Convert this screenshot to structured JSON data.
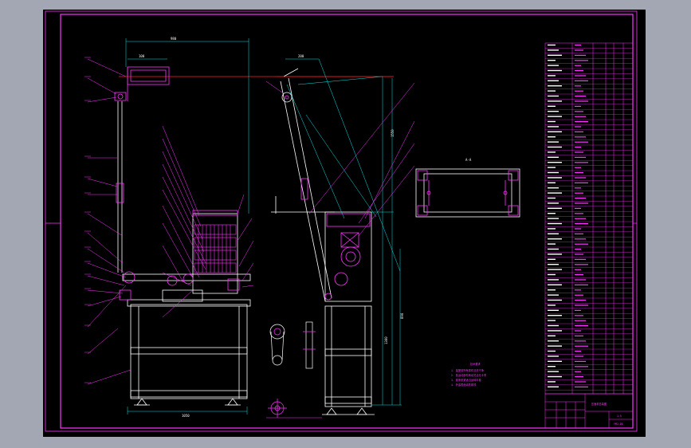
{
  "colors": {
    "viewport_bg": "#a3a7b3",
    "canvas_bg": "#000000",
    "frame": "#ff33ff",
    "geometry": "#ffffff",
    "dimension": "#00e5e5",
    "center_line": "#ff2222",
    "leader": "#ff33ff",
    "detail": "#ff33ff"
  },
  "views": {
    "front": "front-view",
    "side": "side-view",
    "section_label": "A-A",
    "detail_a": "detail-view-pulley",
    "detail_b": "detail-view-shaft",
    "detail_c": "detail-view-bearing"
  },
  "dimensions": {
    "top_width": "980",
    "top_short": "100",
    "base_width": "1050",
    "side_top": "200",
    "side_height": "1550",
    "side_mid": "1300",
    "side_right": "890"
  },
  "notes": {
    "heading": "技术要求",
    "lines": [
      "1. 装配前所有零件清洗干净",
      "2. 各运动部件转动灵活无卡滞",
      "3. 链条张紧适当运转平稳",
      "4. 外露表面涂防锈漆"
    ]
  },
  "bom": {
    "rows_count_label": "",
    "prefix": "YYM"
  },
  "title_block": {
    "drawing_title": "压面机总装图",
    "scale": "1:5",
    "drawing_no": "YMJ-00"
  }
}
